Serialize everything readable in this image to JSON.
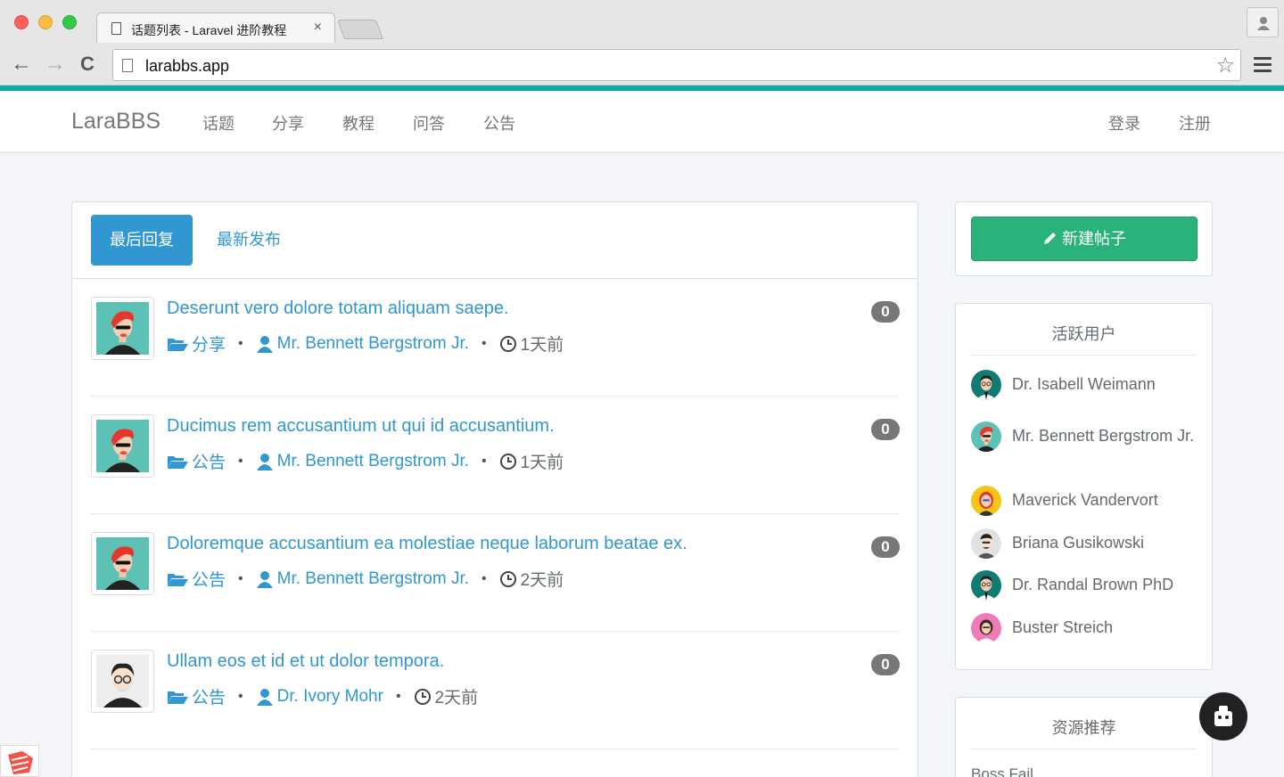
{
  "browser": {
    "tab_title": "话题列表 - Laravel 进阶教程",
    "tab_close": "×",
    "url": "larabbs.app",
    "back": "←",
    "forward": "→",
    "reload": "C",
    "star": "☆"
  },
  "navbar": {
    "brand": "LaraBBS",
    "links": [
      "话题",
      "分享",
      "教程",
      "问答",
      "公告"
    ],
    "login": "登录",
    "register": "注册"
  },
  "tabs": {
    "active": "最后回复",
    "other": "最新发布"
  },
  "topics": [
    {
      "title": "Deserunt vero dolore totam aliquam saepe.",
      "category": "分享",
      "author": "Mr. Bennett Bergstrom Jr.",
      "time": "1天前",
      "replies": "0",
      "avatar": "red-hair"
    },
    {
      "title": "Ducimus rem accusantium ut qui id accusantium.",
      "category": "公告",
      "author": "Mr. Bennett Bergstrom Jr.",
      "time": "1天前",
      "replies": "0",
      "avatar": "red-hair"
    },
    {
      "title": "Doloremque accusantium ea molestiae neque laborum beatae ex.",
      "category": "公告",
      "author": "Mr. Bennett Bergstrom Jr.",
      "time": "2天前",
      "replies": "0",
      "avatar": "red-hair"
    },
    {
      "title": "Ullam eos et id et ut dolor tempora.",
      "category": "公告",
      "author": "Dr. Ivory Mohr",
      "time": "2天前",
      "replies": "0",
      "avatar": "glasses-gray"
    }
  ],
  "sidebar": {
    "new_post": "新建帖子",
    "active_users_title": "活跃用户",
    "active_users": [
      {
        "name": "Dr. Isabell Weimann",
        "avatar": "teal-man"
      },
      {
        "name": "Mr. Bennett Bergstrom Jr.",
        "avatar": "red-hair"
      },
      {
        "name": "Maverick Vandervort",
        "avatar": "yellow-woman"
      },
      {
        "name": "Briana Gusikowski",
        "avatar": "gray-man"
      },
      {
        "name": "Dr. Randal Brown PhD",
        "avatar": "teal-man"
      },
      {
        "name": "Buster Streich",
        "avatar": "pink-woman"
      }
    ],
    "resources_title": "资源推荐",
    "resource_first": "Boss Fail"
  }
}
